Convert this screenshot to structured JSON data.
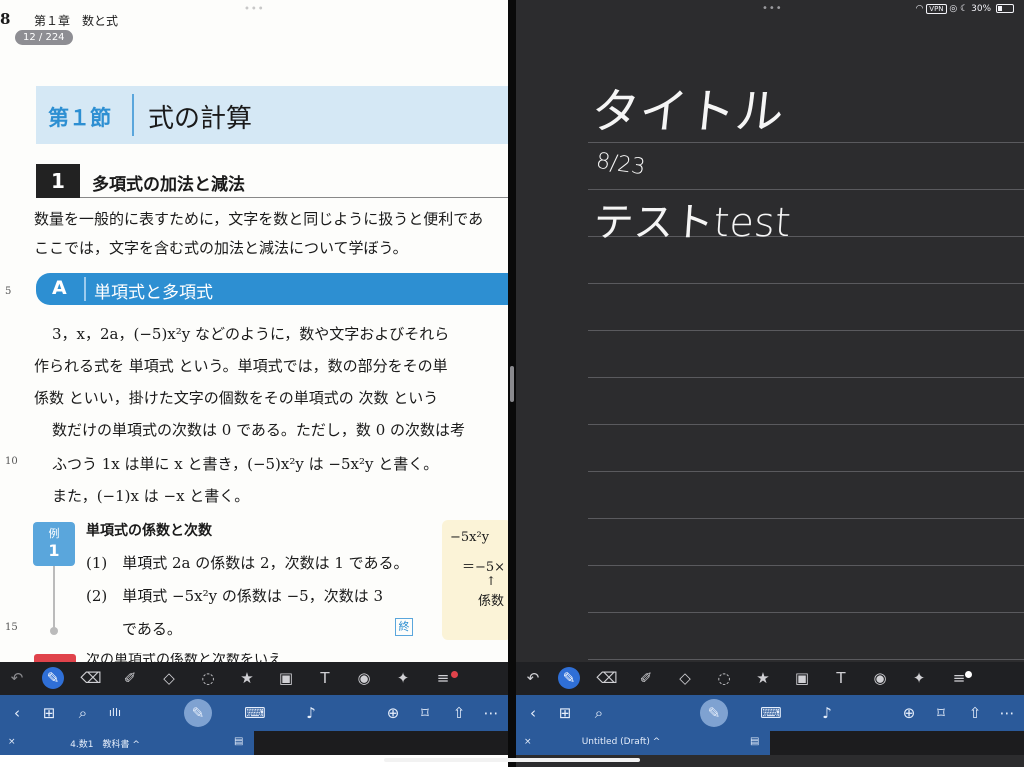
{
  "left_pane": {
    "page_number": "8",
    "chapter_header": "第１章　数と式",
    "page_indicator": "12 / 224",
    "section_num": "第１節",
    "section_title": "式の計算",
    "subsection_num": "1",
    "subsection_title": "多項式の加法と減法",
    "intro_lines": [
      "数量を一般的に表すために，文字を数と同じように扱うと便利であ",
      "ここでは，文字を含む式の加法と減法について学ぼう。"
    ],
    "topic_letter": "A",
    "topic_title": "単項式と多項式",
    "line_numbers": [
      "5",
      "10",
      "15"
    ],
    "body_lines": [
      "3，x，2a，(−5)x²y などのように，数や文字およびそれら",
      "作られる式を 単項式 という。単項式では，数の部分をその単",
      "係数 といい，掛けた文字の個数をその単項式の 次数 という",
      "数だけの単項式の次数は 0 である。ただし，数 0 の次数は考",
      "ふつう 1x は単に x と書き，(−5)x²y は −5x²y と書く。",
      "また，(−1)x は −x と書く。"
    ],
    "example_label": "例",
    "example_num": "1",
    "example_title": "単項式の係数と次数",
    "example_lines": [
      "(1)　単項式 2a の係数は 2，次数は 1 である。",
      "(2)　単項式 −5x²y の係数は −5，次数は 3",
      "である。"
    ],
    "end_mark": "終",
    "side_note": [
      "−5x²y",
      "＝−5×",
      "↑",
      "係数"
    ],
    "next_line": "次の単項式の係数と次数をいえ",
    "tab_title": "4.数1　教科書"
  },
  "right_pane": {
    "status": {
      "vpn": "VPN",
      "battery": "30%",
      "battery_fraction": 0.3
    },
    "handwriting": {
      "title": "タイトル",
      "date": "8/23",
      "text": "テストtest"
    },
    "tab_title": "Untitled (Draft)"
  },
  "toolbar_icons": {
    "undo": "↶",
    "pen": "✎",
    "eraser": "⌫",
    "highlighter": "✐",
    "shapes": "◇",
    "lasso": "◌",
    "sticker": "★",
    "image": "▣",
    "text": "T",
    "camera": "◉",
    "laser": "✦",
    "width": "≡"
  },
  "nav_icons": {
    "back": "‹",
    "grid": "⊞",
    "search": "⌕",
    "audio": "ıllı",
    "pen": "✎",
    "keyboard": "⌨",
    "mic": "♪",
    "add_page": "⊕",
    "bookmark": "⌑",
    "share": "⇧",
    "more": "⋯",
    "close": "×",
    "caret": "^",
    "tab_icon": "▤"
  },
  "colors": {
    "accent_blue": "#2d8fd2",
    "nav_blue": "#2b5a9a",
    "toolbar_dark": "#1f2023",
    "note_bg": "#2c2c2e",
    "red_dot": "#e0434b"
  }
}
